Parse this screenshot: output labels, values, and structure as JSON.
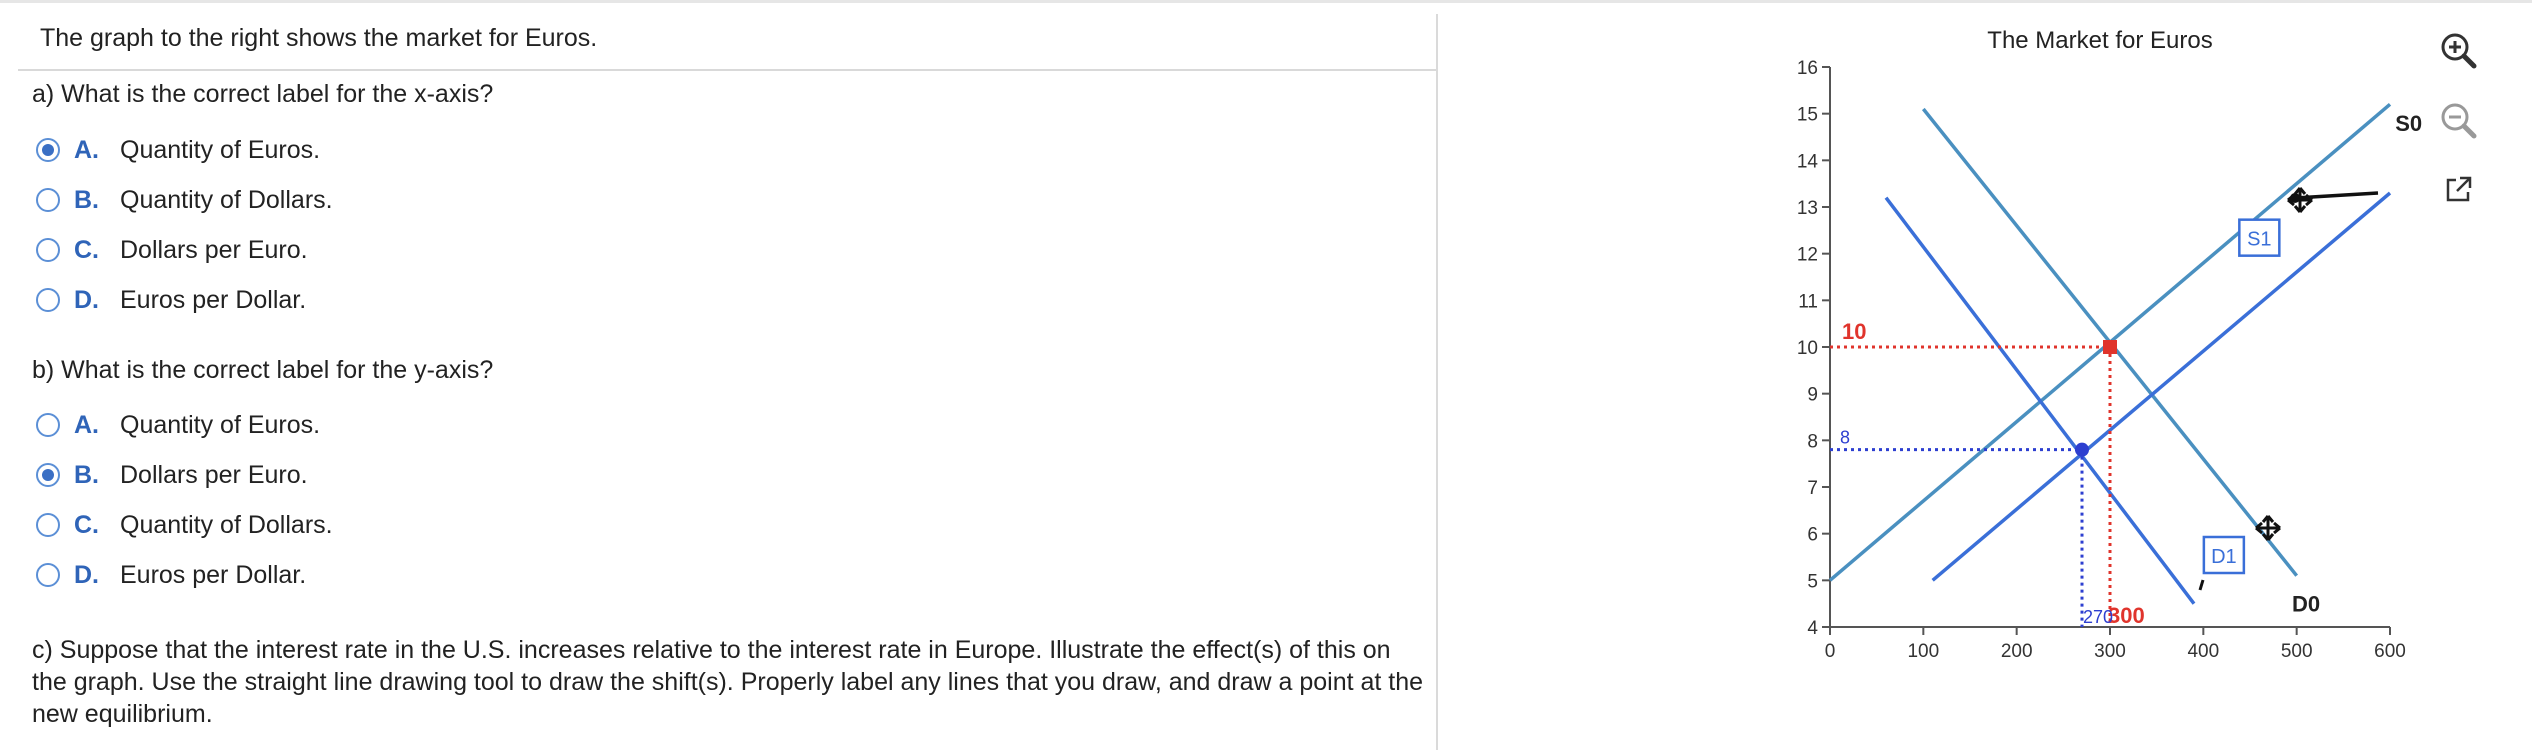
{
  "intro": "The graph to the right shows the market for Euros.",
  "question_a": {
    "prompt": "a) What is the correct label for the x-axis?",
    "options": [
      {
        "letter": "A.",
        "text": "Quantity of Euros.",
        "selected": true
      },
      {
        "letter": "B.",
        "text": "Quantity of Dollars.",
        "selected": false
      },
      {
        "letter": "C.",
        "text": "Dollars per Euro.",
        "selected": false
      },
      {
        "letter": "D.",
        "text": "Euros per Dollar.",
        "selected": false
      }
    ]
  },
  "question_b": {
    "prompt": "b) What is the correct label for the y-axis?",
    "options": [
      {
        "letter": "A.",
        "text": "Quantity of Euros.",
        "selected": false
      },
      {
        "letter": "B.",
        "text": "Dollars per Euro.",
        "selected": true
      },
      {
        "letter": "C.",
        "text": "Quantity of Dollars.",
        "selected": false
      },
      {
        "letter": "D.",
        "text": "Euros per Dollar.",
        "selected": false
      }
    ]
  },
  "question_c": "c) Suppose that the interest rate in the U.S. increases relative to the interest rate in Europe.  Illustrate the effect(s) of this on the graph.  Use the straight line drawing tool to draw the shift(s).  Properly label any lines that you draw, and draw a point at the new equilibrium.",
  "tools": {
    "zoom_in": "zoom-in-icon",
    "zoom_out": "zoom-out-icon",
    "popout": "external-link-icon"
  },
  "chart_data": {
    "type": "line",
    "title": "The Market for Euros",
    "xlim": [
      0,
      600
    ],
    "ylim": [
      4,
      16
    ],
    "xticks": [
      0,
      100,
      200,
      300,
      400,
      500,
      600
    ],
    "yticks": [
      4,
      5,
      6,
      7,
      8,
      9,
      10,
      11,
      12,
      13,
      14,
      15,
      16
    ],
    "colors": {
      "original": "#4a90c0",
      "drawn": "#3a6fd8",
      "red": "#e0342c",
      "blue": "#2d3fd0"
    },
    "lines": [
      {
        "name": "S0",
        "kind": "original",
        "points": [
          [
            0,
            5
          ],
          [
            600,
            15.2
          ]
        ]
      },
      {
        "name": "D0",
        "kind": "original",
        "points": [
          [
            100,
            15.1
          ],
          [
            500,
            5.1
          ]
        ]
      },
      {
        "name": "S1",
        "kind": "drawn",
        "points": [
          [
            110,
            5.0
          ],
          [
            600,
            13.3
          ]
        ]
      },
      {
        "name": "D1",
        "kind": "drawn",
        "points": [
          [
            60,
            13.2
          ],
          [
            390,
            4.5
          ]
        ]
      }
    ],
    "equilibria": [
      {
        "x": 300,
        "y": 10,
        "x_label": "300",
        "y_label": "10",
        "color": "red"
      },
      {
        "x": 270,
        "y": 7.8,
        "x_label": "270",
        "y_label": "8",
        "color": "blue"
      }
    ],
    "line_labels": [
      {
        "text": "S0",
        "x": 620,
        "y": 14.8,
        "boxed": false
      },
      {
        "text": "D0",
        "x": 510,
        "y": 4.5,
        "boxed": false
      },
      {
        "text": "S1",
        "x": 460,
        "y": 12.3,
        "boxed": true
      },
      {
        "text": "D1",
        "x": 422,
        "y": 5.5,
        "boxed": true
      }
    ],
    "grid": false
  }
}
